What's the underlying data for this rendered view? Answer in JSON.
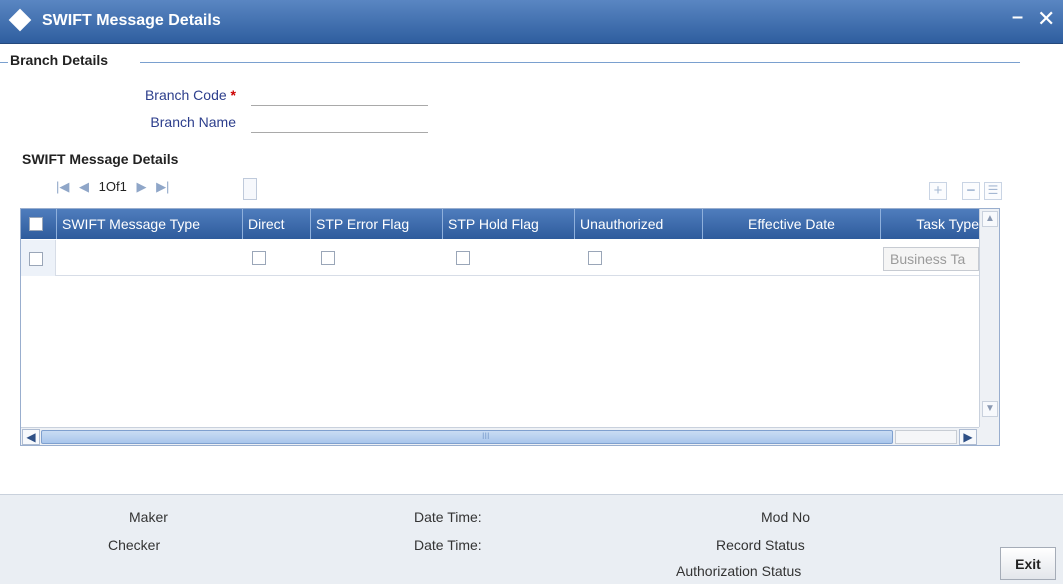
{
  "window": {
    "title": "SWIFT Message Details",
    "minimize_label": "–",
    "close_label": "✕"
  },
  "branch_section": {
    "legend": "Branch Details",
    "branch_code_label": "Branch Code",
    "required_mark": "*",
    "branch_code_value": "",
    "branch_name_label": "Branch Name",
    "branch_name_value": ""
  },
  "grid_section": {
    "title": "SWIFT Message Details",
    "pager": {
      "first_icon": "first-page-icon",
      "prev_icon": "prev-page-icon",
      "page_text": "1Of1",
      "next_icon": "next-page-icon",
      "last_icon": "last-page-icon"
    },
    "tools": {
      "add_icon": "plus-icon",
      "delete_icon": "minus-icon",
      "view_icon": "list-view-icon"
    },
    "columns": [
      "SWIFT Message Type",
      "Direct",
      "STP Error Flag",
      "STP Hold Flag",
      "Unauthorized",
      "Effective Date",
      "Task Type"
    ],
    "rows": [
      {
        "swift_message_type": "",
        "direct": false,
        "stp_error_flag": false,
        "stp_hold_flag": false,
        "unauthorized": false,
        "effective_date": "",
        "task_type_button": "Business Ta"
      }
    ],
    "hscroll_grip": "III"
  },
  "footer": {
    "maker_label": "Maker",
    "checker_label": "Checker",
    "maker_datetime_label": "Date Time:",
    "checker_datetime_label": "Date Time:",
    "mod_no_label": "Mod No",
    "record_status_label": "Record Status",
    "authorization_status_label": "Authorization Status",
    "exit_label": "Exit"
  },
  "colors": {
    "titlebar": "#2f5e9f",
    "grid_header": "#3d6aac",
    "accent_label": "#2c3e8c",
    "required": "#cc0000"
  }
}
